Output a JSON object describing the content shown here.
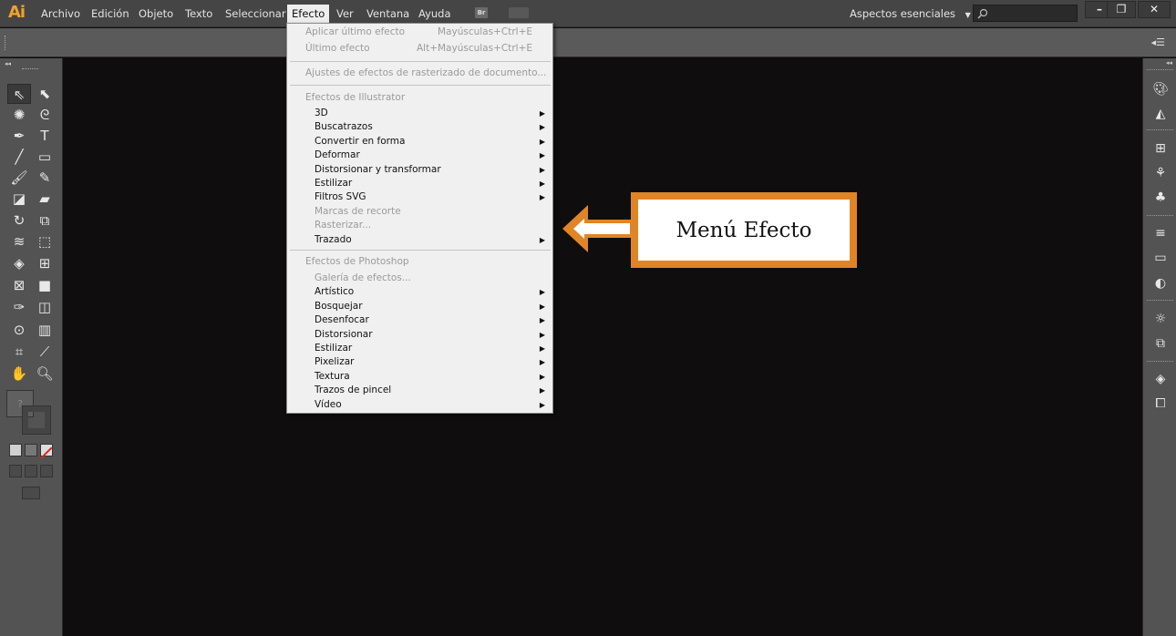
{
  "app": {
    "logo": "Ai"
  },
  "menubar": {
    "items": [
      "Archivo",
      "Edición",
      "Objeto",
      "Texto",
      "Seleccionar",
      "Efecto",
      "Ver",
      "Ventana",
      "Ayuda"
    ],
    "active": "Efecto",
    "bridge_label": "Br",
    "workspace": "Aspectos esenciales",
    "window_buttons": [
      "–",
      "❐",
      "✕"
    ]
  },
  "effect_menu": {
    "top_items": [
      {
        "label": "Aplicar último efecto",
        "shortcut": "Mayúsculas+Ctrl+E",
        "disabled": true
      },
      {
        "label": "Último efecto",
        "shortcut": "Alt+Mayúsculas+Ctrl+E",
        "disabled": true
      }
    ],
    "raster_settings": "Ajustes de efectos de rasterizado de documento...",
    "illustrator_header": "Efectos de Illustrator",
    "illustrator_items": [
      {
        "label": "3D",
        "submenu": true,
        "disabled": false
      },
      {
        "label": "Buscatrazos",
        "submenu": true,
        "disabled": false
      },
      {
        "label": "Convertir en forma",
        "submenu": true,
        "disabled": false
      },
      {
        "label": "Deformar",
        "submenu": true,
        "disabled": false
      },
      {
        "label": "Distorsionar y transformar",
        "submenu": true,
        "disabled": false
      },
      {
        "label": "Estilizar",
        "submenu": true,
        "disabled": false
      },
      {
        "label": "Filtros SVG",
        "submenu": true,
        "disabled": false
      },
      {
        "label": "Marcas de recorte",
        "submenu": false,
        "disabled": true
      },
      {
        "label": "Rasterizar...",
        "submenu": false,
        "disabled": true
      },
      {
        "label": "Trazado",
        "submenu": true,
        "disabled": false
      }
    ],
    "photoshop_header": "Efectos de Photoshop",
    "photoshop_items": [
      {
        "label": "Galería de efectos...",
        "submenu": false,
        "disabled": true
      },
      {
        "label": "Artístico",
        "submenu": true,
        "disabled": false
      },
      {
        "label": "Bosquejar",
        "submenu": true,
        "disabled": false
      },
      {
        "label": "Desenfocar",
        "submenu": true,
        "disabled": false
      },
      {
        "label": "Distorsionar",
        "submenu": true,
        "disabled": false
      },
      {
        "label": "Estilizar",
        "submenu": true,
        "disabled": false
      },
      {
        "label": "Pixelizar",
        "submenu": true,
        "disabled": false
      },
      {
        "label": "Textura",
        "submenu": true,
        "disabled": false
      },
      {
        "label": "Trazos de pincel",
        "submenu": true,
        "disabled": false
      },
      {
        "label": "Vídeo",
        "submenu": true,
        "disabled": false
      }
    ]
  },
  "callout": {
    "text": "Menú Efecto",
    "color": "#e08525"
  },
  "colors": {
    "accent": "#f0a030",
    "menubar_bg": "#454545",
    "panel_bg": "#535353",
    "canvas_bg": "#0f0d0d"
  }
}
